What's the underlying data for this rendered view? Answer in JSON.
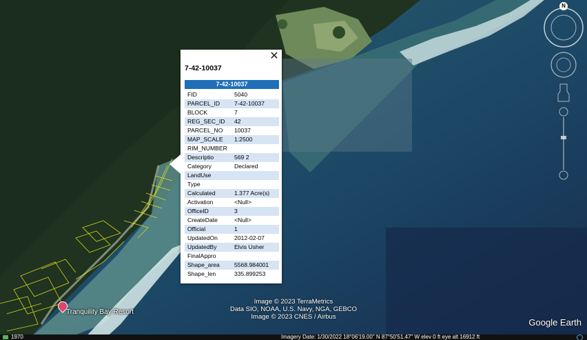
{
  "popup": {
    "title": "7-42-10037",
    "header": "7-42-10037",
    "close_glyph": "✕",
    "rows": [
      {
        "key": "FID",
        "value": "5040"
      },
      {
        "key": "PARCEL_ID",
        "value": "7-42-10037"
      },
      {
        "key": "BLOCK",
        "value": "7"
      },
      {
        "key": "REG_SEC_ID",
        "value": "42"
      },
      {
        "key": "PARCEL_NO",
        "value": "10037"
      },
      {
        "key": "MAP_SCALE",
        "value": "1:2500"
      },
      {
        "key": "RIM_NUMBER",
        "value": ""
      },
      {
        "key": "Descriptio",
        "value": "569 2"
      },
      {
        "key": "Category",
        "value": "Declared"
      },
      {
        "key": "LandUse",
        "value": ""
      },
      {
        "key": "Type",
        "value": ""
      },
      {
        "key": "Calculated",
        "value": "1.377 Acre(s)"
      },
      {
        "key": "Activation",
        "value": "<Null>"
      },
      {
        "key": "OfficeID",
        "value": "3"
      },
      {
        "key": "CreateDate",
        "value": "<Null>"
      },
      {
        "key": "Official",
        "value": "1"
      },
      {
        "key": "UpdatedOn",
        "value": "2012-02-07"
      },
      {
        "key": "UpdatedBy",
        "value": "Elvis Usher"
      },
      {
        "key": "FinalAppro",
        "value": ""
      },
      {
        "key": "Shape_area",
        "value": "5568.984001"
      },
      {
        "key": "Shape_len",
        "value": "335.899253"
      }
    ]
  },
  "map": {
    "place_label": "Tranquility Bay Resort",
    "credits": [
      "Image © 2023 TerraMetrics",
      "Data SIO, NOAA, U.S. Navy, NGA, GEBCO",
      "Image © 2023 CNES / Airbus"
    ],
    "brand": "Google Earth",
    "compass_letter": "N"
  },
  "statusbar": {
    "historical_year": "1970",
    "info": "Imagery Date: 1/30/2022    18°06'19.00\" N    87°50'51.47\" W    elev    0 ft    eye alt  16912 ft"
  },
  "colors": {
    "header_blue": "#1e6fb8",
    "row_alt": "#d6e4f4",
    "parcel_lines": "#e6e619"
  }
}
